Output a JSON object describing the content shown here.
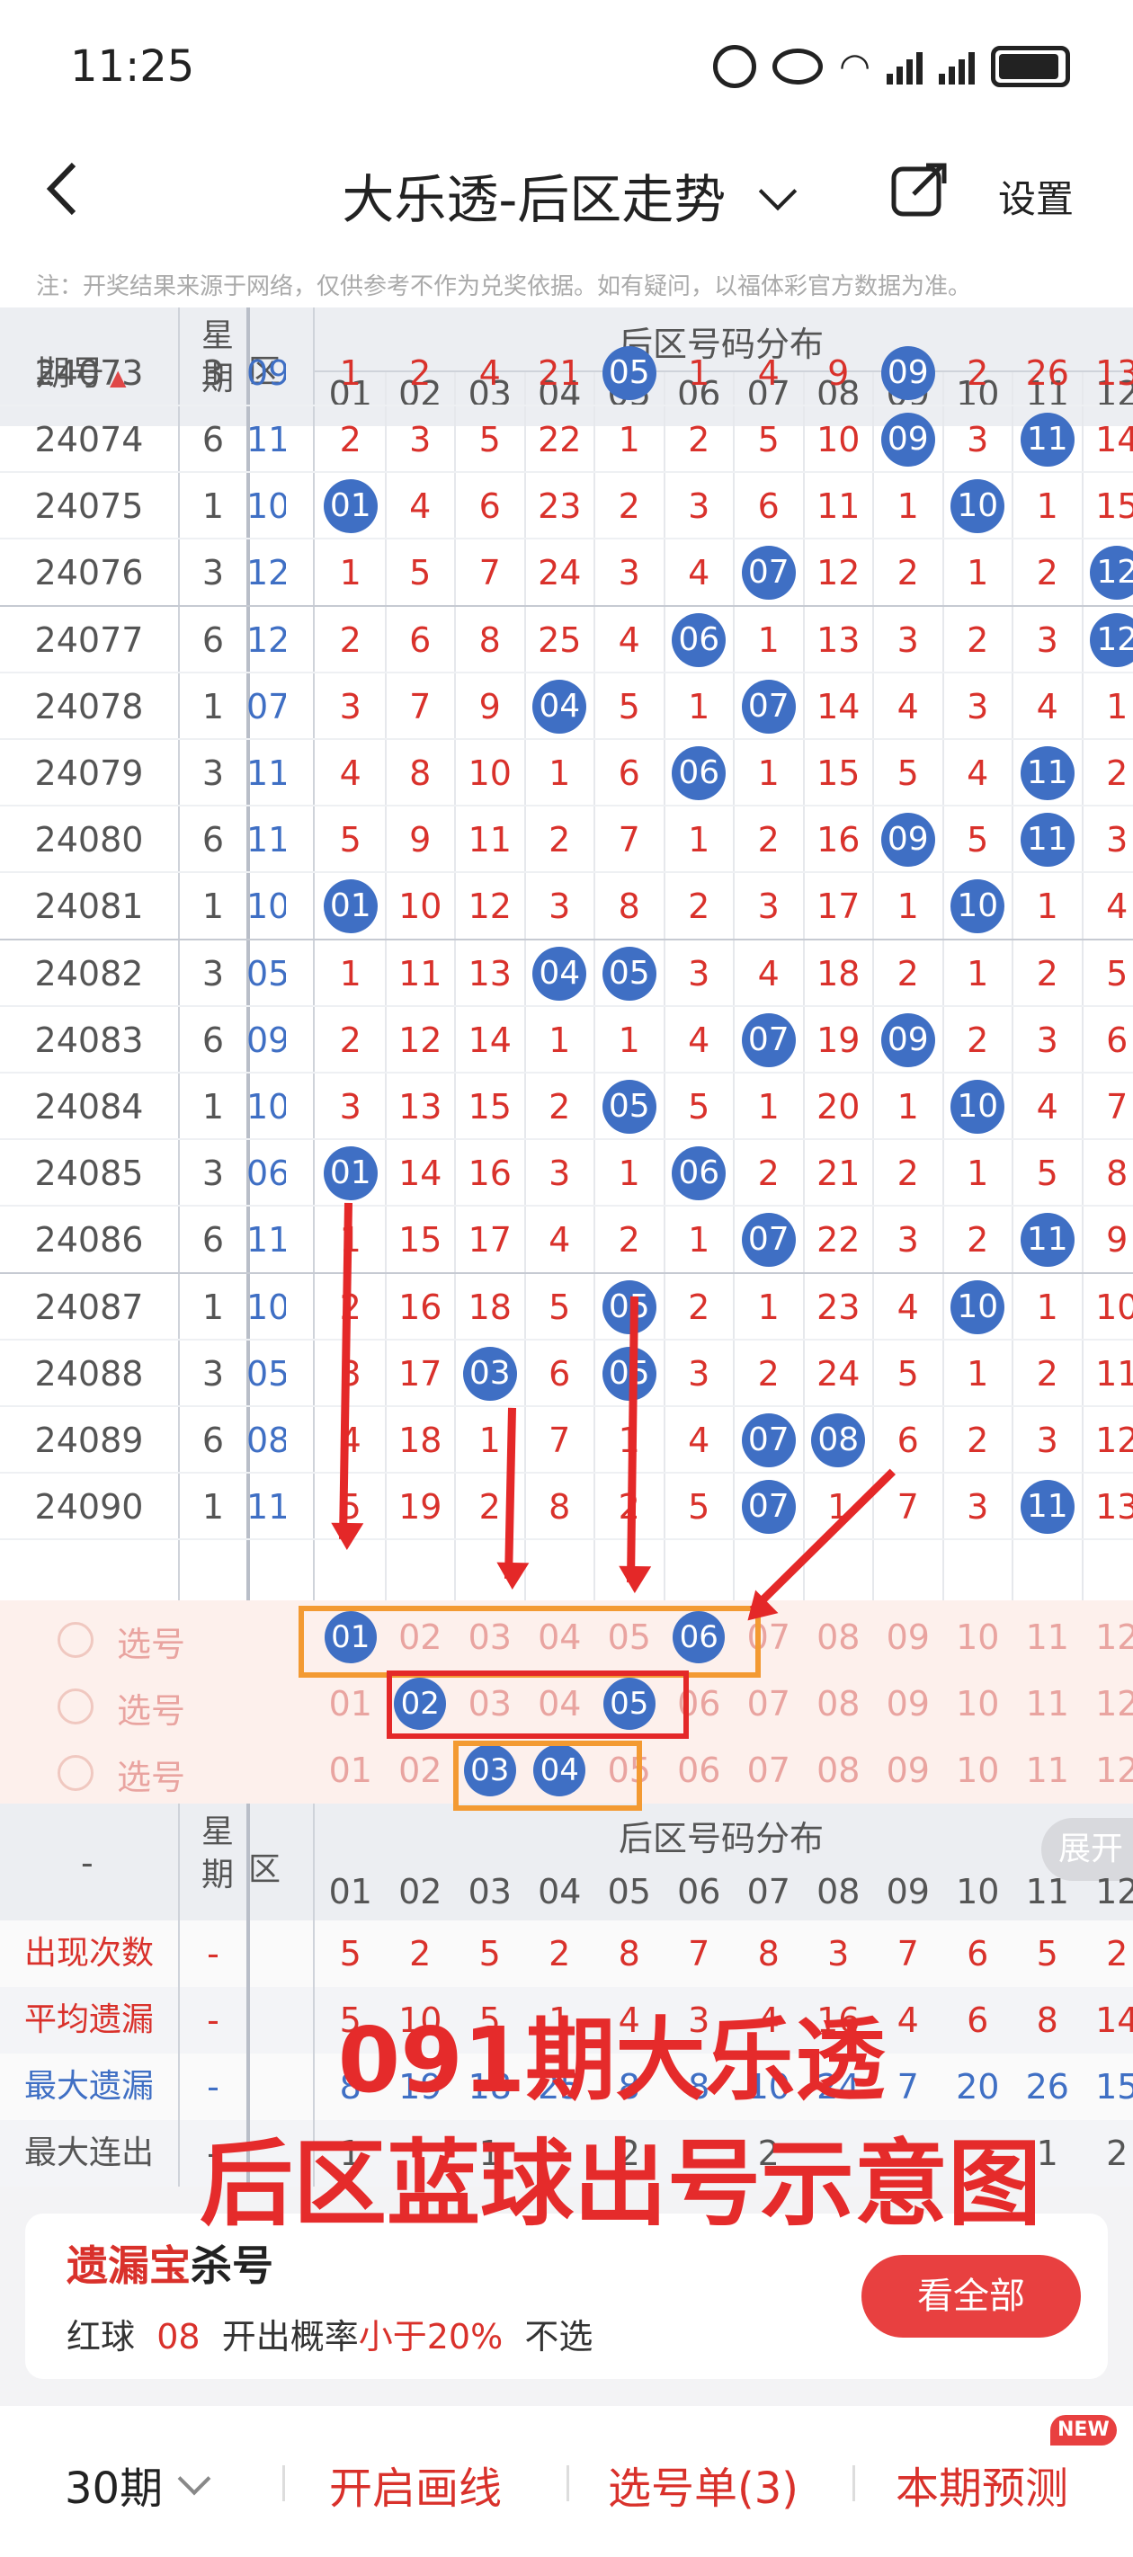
{
  "status": {
    "time": "11:25",
    "battery_icon": "battery-icon",
    "signal_icon": "signal-icon",
    "wifi_icon": "wifi-icon"
  },
  "nav": {
    "title": "大乐透-后区走势",
    "settings": "设置"
  },
  "notice": "注：开奖结果来源于网络，仅供参考不作为兑奖依据。如有疑问，以福体彩官方数据为准。",
  "table_header": {
    "period": "期号",
    "week": "星期",
    "zone_short": "区",
    "dist": "后区号码分布",
    "numbers": [
      "01",
      "02",
      "03",
      "04",
      "05",
      "06",
      "07",
      "08",
      "09",
      "10",
      "11",
      "12"
    ]
  },
  "rows": [
    {
      "p": "24073",
      "w": "3",
      "z": "09",
      "v": [
        "1",
        "2",
        "4",
        "21",
        "05",
        "1",
        "4",
        "9",
        "09",
        "2",
        "26",
        "13"
      ]
    },
    {
      "p": "24074",
      "w": "6",
      "z": "11",
      "v": [
        "2",
        "3",
        "5",
        "22",
        "1",
        "2",
        "5",
        "10",
        "09",
        "3",
        "11",
        "14"
      ]
    },
    {
      "p": "24075",
      "w": "1",
      "z": "10",
      "v": [
        "01",
        "4",
        "6",
        "23",
        "2",
        "3",
        "6",
        "11",
        "1",
        "10",
        "1",
        "15"
      ]
    },
    {
      "p": "24076",
      "w": "3",
      "z": "12",
      "v": [
        "1",
        "5",
        "7",
        "24",
        "3",
        "4",
        "07",
        "12",
        "2",
        "1",
        "2",
        "12"
      ]
    },
    {
      "p": "24077",
      "w": "6",
      "z": "12",
      "v": [
        "2",
        "6",
        "8",
        "25",
        "4",
        "06",
        "1",
        "13",
        "3",
        "2",
        "3",
        "12"
      ]
    },
    {
      "p": "24078",
      "w": "1",
      "z": "07",
      "v": [
        "3",
        "7",
        "9",
        "04",
        "5",
        "1",
        "07",
        "14",
        "4",
        "3",
        "4",
        "1"
      ]
    },
    {
      "p": "24079",
      "w": "3",
      "z": "11",
      "v": [
        "4",
        "8",
        "10",
        "1",
        "6",
        "06",
        "1",
        "15",
        "5",
        "4",
        "11",
        "2"
      ]
    },
    {
      "p": "24080",
      "w": "6",
      "z": "11",
      "v": [
        "5",
        "9",
        "11",
        "2",
        "7",
        "1",
        "2",
        "16",
        "09",
        "5",
        "11",
        "3"
      ]
    },
    {
      "p": "24081",
      "w": "1",
      "z": "10",
      "v": [
        "01",
        "10",
        "12",
        "3",
        "8",
        "2",
        "3",
        "17",
        "1",
        "10",
        "1",
        "4"
      ]
    },
    {
      "p": "24082",
      "w": "3",
      "z": "05",
      "v": [
        "1",
        "11",
        "13",
        "04",
        "05",
        "3",
        "4",
        "18",
        "2",
        "1",
        "2",
        "5"
      ]
    },
    {
      "p": "24083",
      "w": "6",
      "z": "09",
      "v": [
        "2",
        "12",
        "14",
        "1",
        "1",
        "4",
        "07",
        "19",
        "09",
        "2",
        "3",
        "6"
      ]
    },
    {
      "p": "24084",
      "w": "1",
      "z": "10",
      "v": [
        "3",
        "13",
        "15",
        "2",
        "05",
        "5",
        "1",
        "20",
        "1",
        "10",
        "4",
        "7"
      ]
    },
    {
      "p": "24085",
      "w": "3",
      "z": "06",
      "v": [
        "01",
        "14",
        "16",
        "3",
        "1",
        "06",
        "2",
        "21",
        "2",
        "1",
        "5",
        "8"
      ]
    },
    {
      "p": "24086",
      "w": "6",
      "z": "11",
      "v": [
        "1",
        "15",
        "17",
        "4",
        "2",
        "1",
        "07",
        "22",
        "3",
        "2",
        "11",
        "9"
      ]
    },
    {
      "p": "24087",
      "w": "1",
      "z": "10",
      "v": [
        "2",
        "16",
        "18",
        "5",
        "05",
        "2",
        "1",
        "23",
        "4",
        "10",
        "1",
        "10"
      ]
    },
    {
      "p": "24088",
      "w": "3",
      "z": "05",
      "v": [
        "3",
        "17",
        "03",
        "6",
        "05",
        "3",
        "2",
        "24",
        "5",
        "1",
        "2",
        "11"
      ]
    },
    {
      "p": "24089",
      "w": "6",
      "z": "08",
      "v": [
        "4",
        "18",
        "1",
        "7",
        "1",
        "4",
        "07",
        "08",
        "6",
        "2",
        "3",
        "12"
      ]
    },
    {
      "p": "24090",
      "w": "1",
      "z": "11",
      "v": [
        "5",
        "19",
        "2",
        "8",
        "2",
        "5",
        "07",
        "1",
        "7",
        "3",
        "11",
        "13"
      ]
    }
  ],
  "balls": [
    [
      0,
      4
    ],
    [
      0,
      8
    ],
    [
      1,
      8
    ],
    [
      1,
      10
    ],
    [
      2,
      0
    ],
    [
      2,
      9
    ],
    [
      3,
      6
    ],
    [
      3,
      11
    ],
    [
      4,
      5
    ],
    [
      4,
      11
    ],
    [
      5,
      3
    ],
    [
      5,
      6
    ],
    [
      6,
      5
    ],
    [
      6,
      10
    ],
    [
      7,
      8
    ],
    [
      7,
      10
    ],
    [
      8,
      0
    ],
    [
      8,
      9
    ],
    [
      9,
      3
    ],
    [
      9,
      4
    ],
    [
      10,
      6
    ],
    [
      10,
      8
    ],
    [
      11,
      4
    ],
    [
      11,
      9
    ],
    [
      12,
      0
    ],
    [
      12,
      5
    ],
    [
      13,
      6
    ],
    [
      13,
      10
    ],
    [
      14,
      4
    ],
    [
      14,
      9
    ],
    [
      15,
      2
    ],
    [
      15,
      4
    ],
    [
      16,
      6
    ],
    [
      16,
      7
    ],
    [
      17,
      6
    ],
    [
      17,
      10
    ]
  ],
  "pick_rows": [
    {
      "label": "选号",
      "balls": [
        "01",
        "06"
      ]
    },
    {
      "label": "选号",
      "balls": [
        "02",
        "05"
      ]
    },
    {
      "label": "选号",
      "balls": [
        "03",
        "04"
      ]
    }
  ],
  "bottom_header": {
    "dash": "-",
    "week": "星期",
    "zone_short": "区",
    "dist": "后区号码分布",
    "expand": "展开"
  },
  "stats": [
    {
      "label": "出现次数",
      "dash": "-",
      "v": [
        "5",
        "2",
        "5",
        "2",
        "8",
        "7",
        "8",
        "3",
        "7",
        "6",
        "5",
        "2"
      ]
    },
    {
      "label": "平均遗漏",
      "dash": "-",
      "v": [
        "5",
        "10",
        "5",
        "1",
        "4",
        "3",
        "4",
        "16",
        "4",
        "6",
        "8",
        "14"
      ]
    },
    {
      "label": "最大遗漏",
      "dash": "-",
      "v": [
        "8",
        "19",
        "18",
        "25",
        "8",
        "8",
        "10",
        "24",
        "7",
        "20",
        "26",
        "15"
      ]
    },
    {
      "label": "最大连出",
      "dash": "-",
      "v": [
        "1",
        "",
        "1",
        "",
        "2",
        "",
        "2",
        "",
        "",
        "",
        "1",
        "2"
      ]
    }
  ],
  "overlay": {
    "line1": "091期大乐透",
    "line2": "后区蓝球出号示意图"
  },
  "card": {
    "title_red": "遗漏宝",
    "title_black": "杀号",
    "text1": "红球",
    "num": "08",
    "text2": "开出概率",
    "text3": "小于20%",
    "text4": "不选",
    "button": "看全部"
  },
  "bottombar": {
    "periods": "30期",
    "draw": "开启画线",
    "list": "选号单(3)",
    "predict": "本期预测",
    "badge": "NEW"
  },
  "colors": {
    "red": "#d9312b",
    "ball": "#3f6fc4",
    "orange": "#f39a32"
  }
}
